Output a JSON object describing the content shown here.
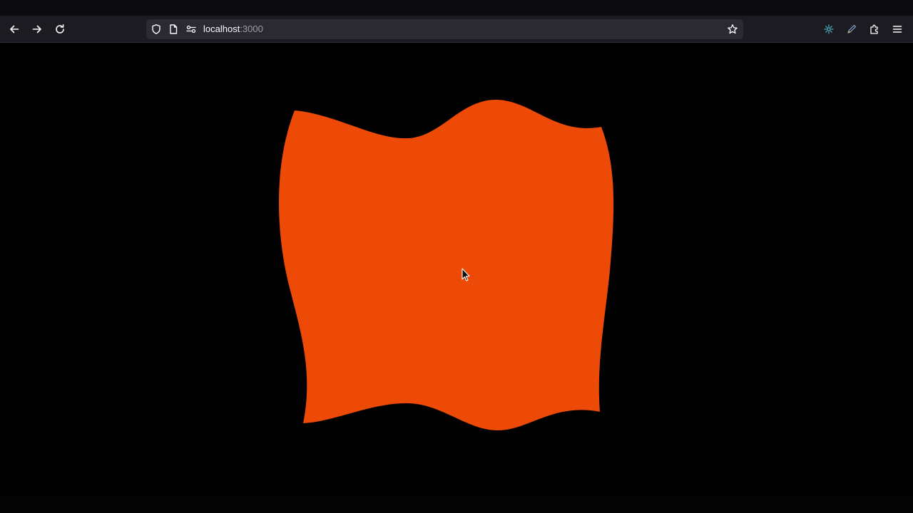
{
  "browser": {
    "url_host": "localhost",
    "url_port": ":3000",
    "icons": {
      "back": "arrow-left-icon",
      "forward": "arrow-right-icon",
      "reload": "reload-icon",
      "shield": "shield-icon",
      "page": "page-icon",
      "permissions": "permissions-icon",
      "bookmark": "star-icon",
      "extension_a": "sparkle-icon",
      "extension_b": "pen-icon",
      "extensions": "puzzle-icon",
      "menu": "hamburger-menu-icon"
    }
  },
  "canvas": {
    "shape_color": "#EC4A06",
    "background_color": "#000000"
  }
}
